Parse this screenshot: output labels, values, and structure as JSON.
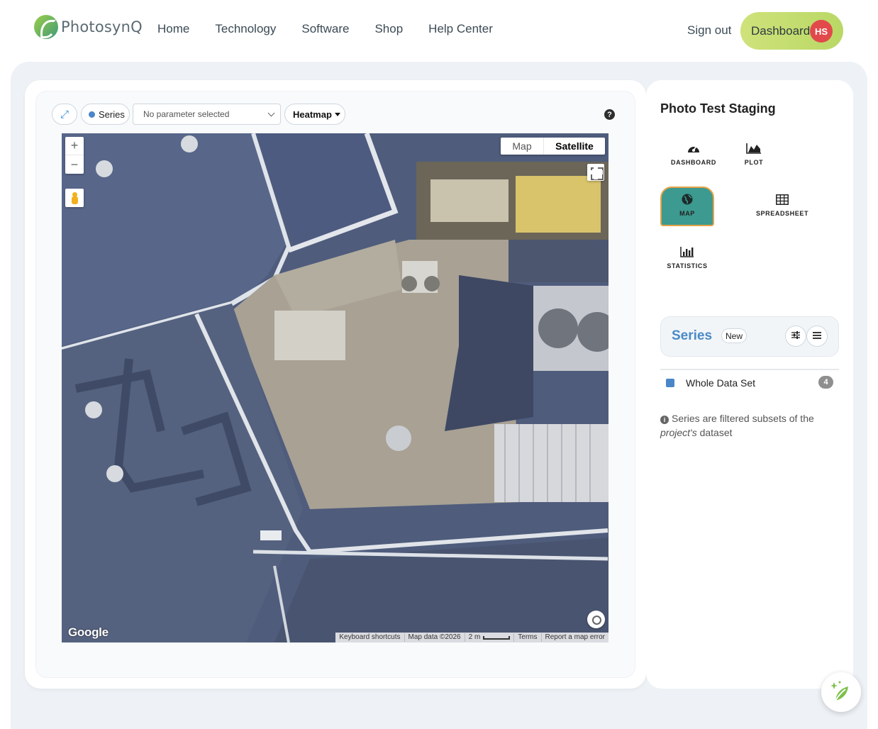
{
  "brand": {
    "name": "PhotosynQ",
    "logo_icon": "photosynq-leaf-icon"
  },
  "nav": {
    "links": [
      "Home",
      "Technology",
      "Software",
      "Shop",
      "Help Center"
    ]
  },
  "account": {
    "sign_out": "Sign out",
    "dashboard": "Dashboard",
    "initials": "HS",
    "avatar_color": "#e2494b"
  },
  "toolbar": {
    "expand_icon": "expand-arrows-icon",
    "series_label": "Series",
    "series_dot_color": "#4a86c8",
    "parameter_select": "No parameter selected",
    "display_mode": "Heatmap",
    "help_icon": "question-circle-icon"
  },
  "map": {
    "zoom_in": "+",
    "zoom_out": "−",
    "map_type_options": [
      "Map",
      "Satellite"
    ],
    "map_type_selected": "Satellite",
    "provider": "Google",
    "attribution": {
      "keyboard": "Keyboard shortcuts",
      "data": "Map data ©2026",
      "scale": "2 m",
      "terms": "Terms",
      "report": "Report a map error"
    }
  },
  "project": {
    "title": "Photo Test Staging",
    "views": [
      {
        "label": "DASHBOARD",
        "icon": "gauge-icon"
      },
      {
        "label": "PLOT",
        "icon": "area-chart-icon"
      },
      {
        "label": "MAP",
        "icon": "globe-icon",
        "active": true
      },
      {
        "label": "SPREADSHEET",
        "icon": "table-icon"
      },
      {
        "label": "STATISTICS",
        "icon": "bar-chart-icon"
      }
    ],
    "active_color": "#3c9a90",
    "active_border": "#e6a349"
  },
  "series_panel": {
    "title": "Series",
    "new_label": "New",
    "items": [
      {
        "name": "Whole Data Set",
        "count": "4",
        "color": "#4a86c8"
      }
    ],
    "note_prefix": "Series are filtered subsets of the",
    "note_em": "project's",
    "note_suffix": "dataset"
  }
}
